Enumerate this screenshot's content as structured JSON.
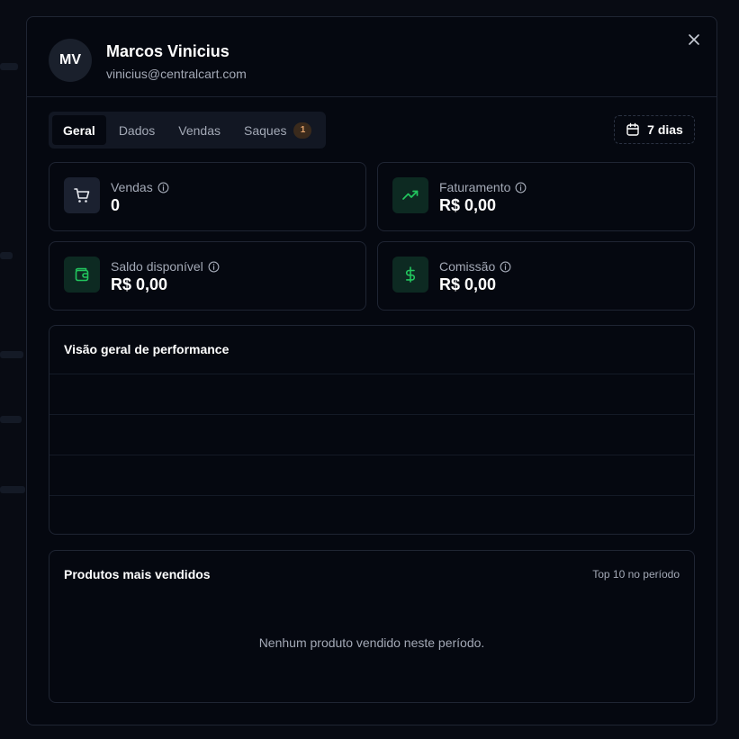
{
  "user": {
    "initials": "MV",
    "name": "Marcos Vinicius",
    "email": "vinicius@centralcart.com"
  },
  "tabs": [
    {
      "label": "Geral",
      "active": true
    },
    {
      "label": "Dados",
      "active": false
    },
    {
      "label": "Vendas",
      "active": false
    },
    {
      "label": "Saques",
      "active": false,
      "badge": "1"
    }
  ],
  "period": {
    "label": "7 dias"
  },
  "stats": {
    "sales": {
      "label": "Vendas",
      "value": "0",
      "icon": "cart-icon"
    },
    "revenue": {
      "label": "Faturamento",
      "value": "R$ 0,00",
      "icon": "trending-up-icon"
    },
    "balance": {
      "label": "Saldo disponível",
      "value": "R$ 0,00",
      "icon": "wallet-icon"
    },
    "commission": {
      "label": "Comissão",
      "value": "R$ 0,00",
      "icon": "dollar-icon"
    }
  },
  "performance": {
    "title": "Visão geral de performance"
  },
  "top_products": {
    "title": "Produtos mais vendidos",
    "subtitle": "Top 10 no período",
    "empty_message": "Nenhum produto vendido neste período."
  },
  "colors": {
    "accent_green": "#22c55e",
    "badge_orange": "#e3a36b",
    "chart_baseline": "#d98a5c"
  }
}
